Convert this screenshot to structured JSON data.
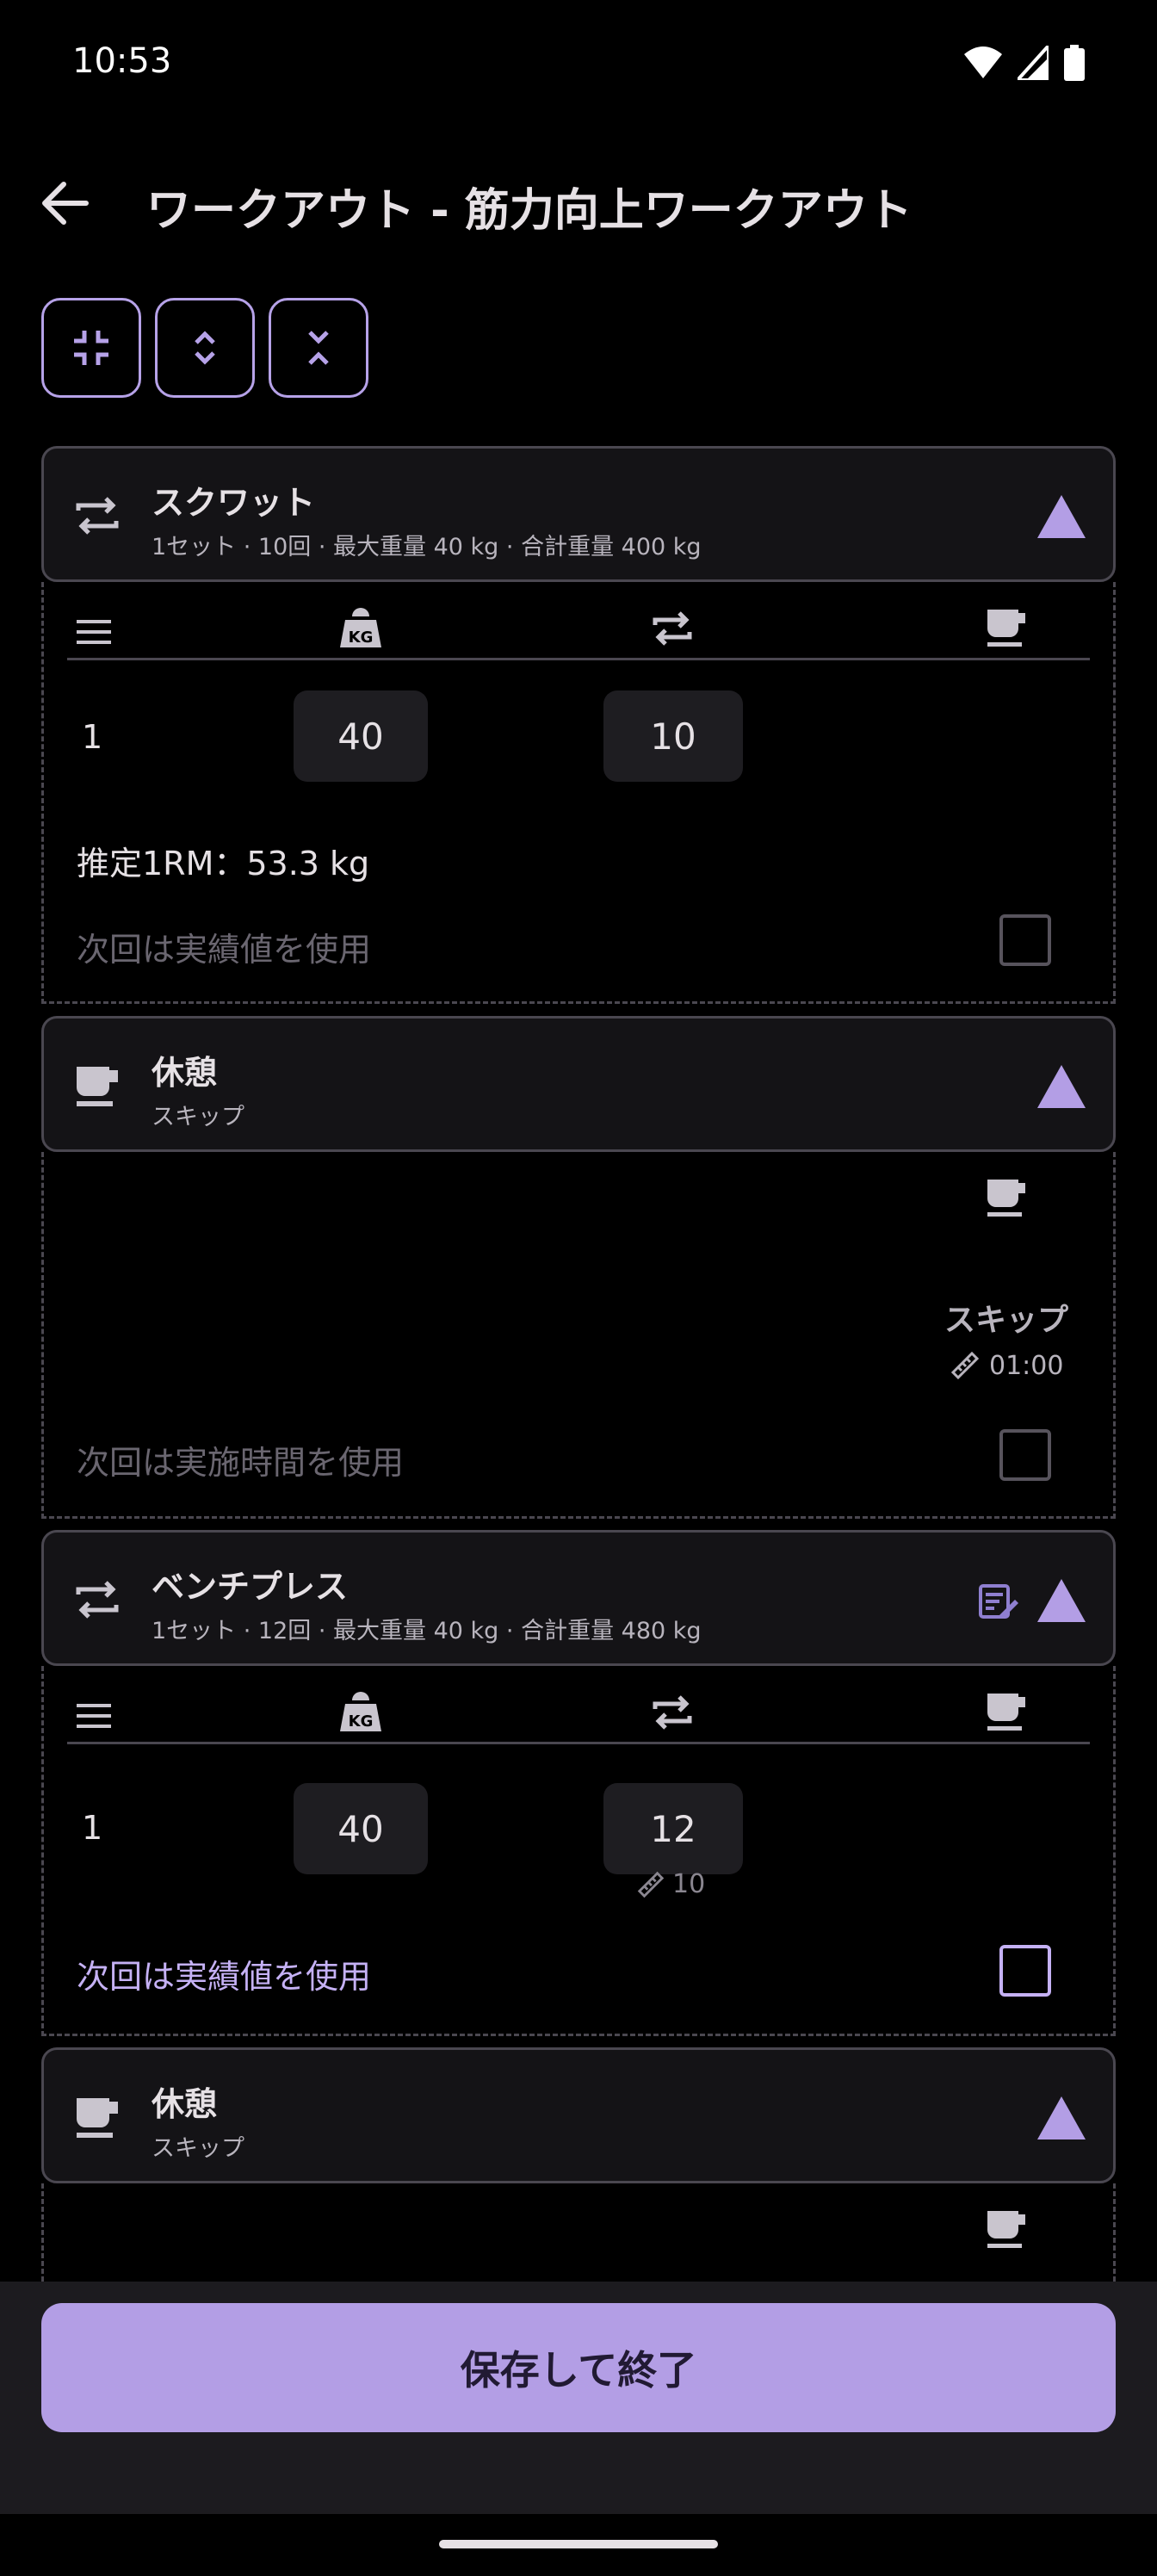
{
  "status_bar": {
    "time": "10:53"
  },
  "header": {
    "title": "ワークアウト - 筋力向上ワークアウト"
  },
  "toolbar": {
    "collapse_all_icon": "collapse-all-icon",
    "expand_icon": "unfold-more-icon",
    "collapse_icon": "unfold-less-icon"
  },
  "exercises": [
    {
      "name": "スクワット",
      "summary": "1セット · 10回 · 最大重量 40 kg · 合計重量 400 kg",
      "sets": [
        {
          "num": "1",
          "weight": "40",
          "reps": "10"
        }
      ],
      "estimated_1rm": "推定1RM：53.3 kg",
      "use_actual_label": "次回は実績値を使用"
    },
    {
      "name": "ベンチプレス",
      "summary": "1セット · 12回 · 最大重量 40 kg · 合計重量 480 kg",
      "sets": [
        {
          "num": "1",
          "weight": "40",
          "reps": "12",
          "target_reps": "10"
        }
      ],
      "use_actual_label": "次回は実績値を使用"
    }
  ],
  "rests": [
    {
      "name": "休憩",
      "summary": "スキップ",
      "status": "スキップ",
      "duration": "01:00",
      "use_time_label": "次回は実施時間を使用"
    },
    {
      "name": "休憩",
      "summary": "スキップ"
    }
  ],
  "footer": {
    "save_label": "保存して終了"
  },
  "colors": {
    "accent": "#b39ee5",
    "card_bg": "#141316",
    "border": "#4a4750"
  }
}
